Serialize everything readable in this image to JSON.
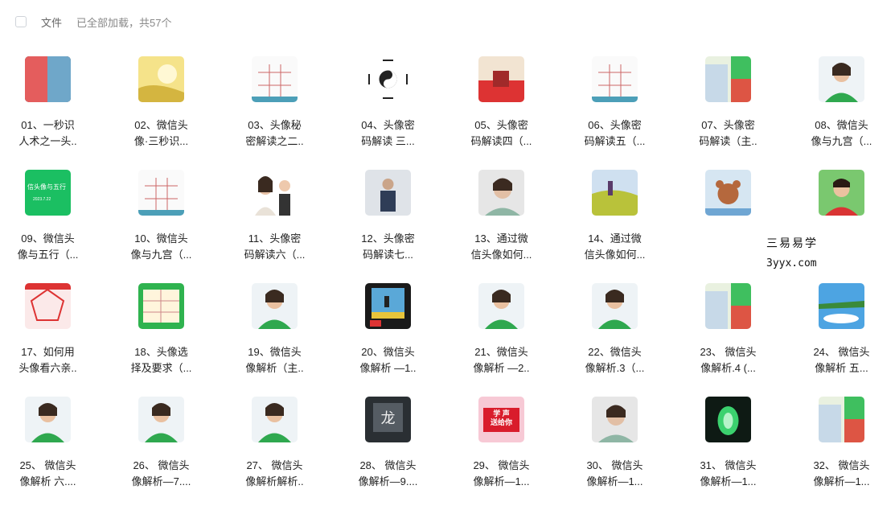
{
  "header": {
    "column_label": "文件",
    "loaded_text": "已全部加载，共57个"
  },
  "items": [
    {
      "label": "01、一秒识\n人术之一头..",
      "thumb": "photo"
    },
    {
      "label": "02、微信头\n像·三秒识...",
      "thumb": "yellow-art"
    },
    {
      "label": "03、头像秘\n密解读之二..",
      "thumb": "diagram"
    },
    {
      "label": "04、头像密\n码解读 三...",
      "thumb": "bagua"
    },
    {
      "label": "05、头像密\n码解读四（...",
      "thumb": "red-photo"
    },
    {
      "label": "06、头像密\n码解读五（...",
      "thumb": "diagram"
    },
    {
      "label": "07、头像密\n码解读（主..",
      "thumb": "green-photo"
    },
    {
      "label": "08、微信头\n像与九宫（...",
      "thumb": "portrait-green"
    },
    {
      "label": "09、微信头\n像与五行（...",
      "thumb": "green-slide",
      "slide_title": "信头像与五行",
      "slide_date": "2023.7.22"
    },
    {
      "label": "10、微信头\n像与九宫（...",
      "thumb": "diagram"
    },
    {
      "label": "11、头像密\n码解读六（...",
      "thumb": "portrait-duo"
    },
    {
      "label": "12、头像密\n码解读七...",
      "thumb": "gray-photo"
    },
    {
      "label": "13、通过微\n信头像如何...",
      "thumb": "portrait"
    },
    {
      "label": "14、通过微\n信头像如何...",
      "thumb": "field"
    },
    {
      "label": "",
      "thumb": "bear"
    },
    {
      "label": "",
      "thumb": "portrait-red"
    },
    {
      "label": "17、如何用\n头像看六亲..",
      "thumb": "red-chart"
    },
    {
      "label": "18、头像选\n择及要求（...",
      "thumb": "green-table"
    },
    {
      "label": "19、微信头\n像解析（主..",
      "thumb": "portrait-green"
    },
    {
      "label": "20、微信头\n像解析 —1..",
      "thumb": "landscape"
    },
    {
      "label": "21、微信头\n像解析 —2..",
      "thumb": "portrait-green"
    },
    {
      "label": "22、微信头\n像解析.3（...",
      "thumb": "portrait-green"
    },
    {
      "label": "23、 微信头\n像解析.4 (...",
      "thumb": "green-photo"
    },
    {
      "label": "24、 微信头\n像解析 五...",
      "thumb": "sky"
    },
    {
      "label": "25、 微信头\n像解析 六....",
      "thumb": "portrait-green"
    },
    {
      "label": "26、 微信头\n像解析—7....",
      "thumb": "portrait-green"
    },
    {
      "label": "27、 微信头\n像解析解析..",
      "thumb": "portrait-green"
    },
    {
      "label": "28、 微信头\n像解析—9....",
      "thumb": "dark"
    },
    {
      "label": "29、 微信头\n像解析—1...",
      "thumb": "red-text",
      "thumb_text": "学 声\n送给你"
    },
    {
      "label": "30、 微信头\n像解析—1...",
      "thumb": "portrait"
    },
    {
      "label": "31、 微信头\n像解析—1...",
      "thumb": "jade"
    },
    {
      "label": "32、 微信头\n像解析—1...",
      "thumb": "green-photo"
    }
  ],
  "watermark": {
    "line1": "三易易学",
    "line2": "3yyx.com"
  }
}
